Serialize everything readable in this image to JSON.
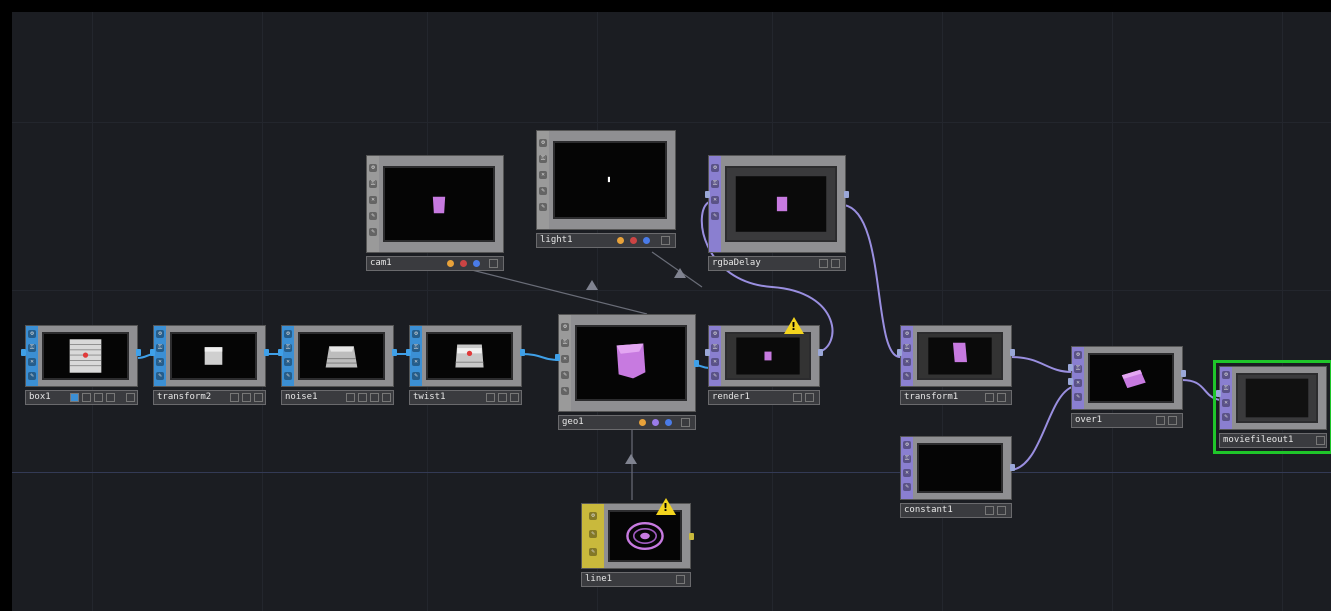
{
  "network": {
    "nodes": {
      "box1": {
        "label": "box1",
        "family": "SOP",
        "icon": "box-preview"
      },
      "transform2": {
        "label": "transform2",
        "family": "SOP",
        "icon": "box-preview"
      },
      "noise1": {
        "label": "noise1",
        "family": "SOP",
        "icon": "noise-preview"
      },
      "twist1": {
        "label": "twist1",
        "family": "SOP",
        "icon": "twist-preview"
      },
      "cam1": {
        "label": "cam1",
        "family": "COMP",
        "icon": "camera-preview"
      },
      "light1": {
        "label": "light1",
        "family": "COMP",
        "icon": "light-preview"
      },
      "geo1": {
        "label": "geo1",
        "family": "COMP",
        "icon": "geometry-preview"
      },
      "line1": {
        "label": "line1",
        "family": "MAT",
        "icon": "line-preview",
        "warning": "!"
      },
      "rgbaDelay": {
        "label": "rgbaDelay",
        "family": "TOP",
        "icon": "delay-preview"
      },
      "render1": {
        "label": "render1",
        "family": "TOP",
        "icon": "render-preview",
        "warning": "!"
      },
      "transform1": {
        "label": "transform1",
        "family": "TOP",
        "icon": "transform-preview"
      },
      "constant1": {
        "label": "constant1",
        "family": "TOP",
        "icon": "constant-preview"
      },
      "over1": {
        "label": "over1",
        "family": "TOP",
        "icon": "composite-preview"
      },
      "moviefileout1": {
        "label": "moviefileout1",
        "family": "TOP",
        "icon": "moviefile-preview",
        "selected": true
      }
    },
    "colors": {
      "background": "#1b1d22",
      "sop": "#3b8fd4",
      "top": "#8a7fd0",
      "comp": "#9a9a9a",
      "mat": "#c9b93c",
      "wire_sop": "#3fa0e8",
      "wire_top": "#9a8fe0",
      "warning": "#f4d51e",
      "selected": "#1fc62a"
    }
  }
}
